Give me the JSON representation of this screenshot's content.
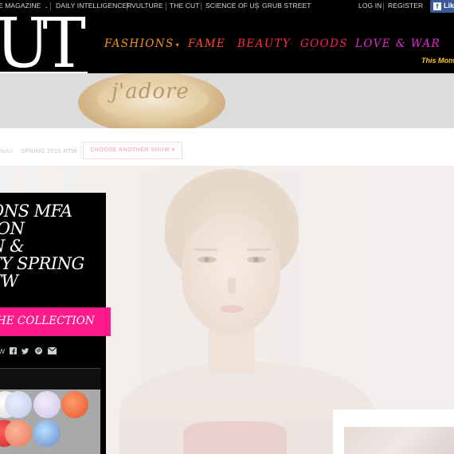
{
  "topbar": {
    "items": [
      "E MAGAZINE",
      "DAILY INTELLIGENCER",
      "VULTURE",
      "THE CUT",
      "SCIENCE OF US",
      "GRUB STREET"
    ],
    "login": "LOG IN",
    "register": "REGISTER",
    "like": "Like",
    "fb_glyph": "f"
  },
  "header": {
    "logo_text": "UT",
    "nav": [
      {
        "label": "FASHIONS",
        "color": "#f7941d",
        "has_dropdown": true
      },
      {
        "label": "FAME",
        "color": "#ff4b2b",
        "has_dropdown": false
      },
      {
        "label": "BEAUTY",
        "color": "#ff2d3c",
        "has_dropdown": false
      },
      {
        "label": "GOODS",
        "color": "#ff1f5f",
        "has_dropdown": false
      },
      {
        "label": "LOVE & WAR",
        "color": "#e62ad2",
        "has_dropdown": false
      }
    ],
    "promo": "This Month"
  },
  "banner": {
    "brand": "j'adore"
  },
  "breadcrumb": {
    "segment1": "WAY",
    "segment2": "SPRING 2015 RTW",
    "choose_label": "CHOOSE ANOTHER SHOW",
    "choose_caret": "▾"
  },
  "panel": {
    "title_lines": [
      "ONS MFA",
      "ION",
      "N &",
      "TY SPRING",
      "TW"
    ],
    "cta_label": "HE COLLECTION",
    "share_label": "W",
    "icons": [
      "facebook-icon",
      "twitter-icon",
      "pinterest-icon",
      "email-icon"
    ]
  },
  "colors": {
    "black": "#000000",
    "cta_pink": "#ff1a8c",
    "promo_yellow": "#ffc61a",
    "fb_blue": "#3b5998"
  }
}
